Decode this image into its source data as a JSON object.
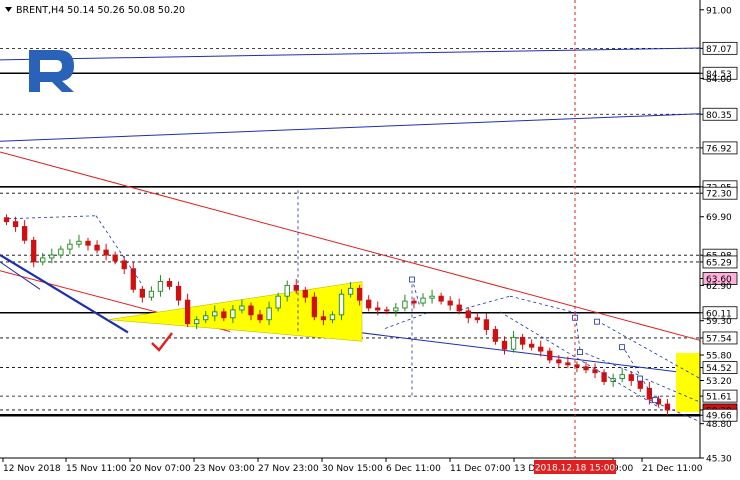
{
  "window": {
    "symbol_line": "BRENT,H4  50.14 50.26 50.08 50.20"
  },
  "logo": {
    "letter": "R",
    "color": "#2a62b8"
  },
  "colors": {
    "candle_bull": "#1a8a1a",
    "candle_bear": "#d01010",
    "trend_red": "#e02020",
    "trend_blue": "#1c2fb0",
    "triangle_fill": "#ffff00",
    "marker_fill": "#ffb0d8",
    "crosshair_label_bg": "#e02020"
  },
  "crosshair": {
    "time_label": "2018.12.18 15:00",
    "price": 63.6
  },
  "price_axis": {
    "ticks": [
      "91.00",
      "87.07",
      "84.53",
      "84.00",
      "80.35",
      "76.92",
      "72.95",
      "72.30",
      "69.90",
      "65.98",
      "65.29",
      "63.60",
      "62.90",
      "60.11",
      "59.30",
      "57.54",
      "55.80",
      "54.52",
      "53.20",
      "51.61",
      "50.20",
      "49.66",
      "48.80",
      "45.30"
    ],
    "boxed": [
      "87.07",
      "84.53",
      "80.35",
      "76.92",
      "72.95",
      "72.30",
      "65.98",
      "65.29",
      "63.60",
      "60.11",
      "57.54",
      "54.52",
      "51.61",
      "50.20",
      "49.66"
    ]
  },
  "time_axis": {
    "labels": [
      "12 Nov 2018",
      "15 Nov 11:00",
      "20 Nov 07:00",
      "23 Nov 03:00",
      "27 Nov 23:00",
      "30 Nov 15:00",
      "6 Dec 11:00",
      "11 Dec 07:00",
      "13 D",
      "9:00",
      "21 Dec 11:00"
    ]
  },
  "icons": {
    "menu": "triangle-down-icon",
    "check": "checkmark-icon"
  },
  "chart_data": {
    "type": "candlestick",
    "ylim": [
      45.3,
      92.0
    ],
    "horizontal_levels": [
      87.07,
      84.53,
      80.35,
      76.92,
      72.95,
      72.3,
      65.98,
      65.29,
      60.11,
      57.54,
      54.52,
      51.61,
      50.2,
      49.66
    ],
    "close_path": [
      69.4,
      68.9,
      67.5,
      65.3,
      65.7,
      66.0,
      66.6,
      67.1,
      67.4,
      67.0,
      66.5,
      66.0,
      65.4,
      64.6,
      62.5,
      61.7,
      62.3,
      63.3,
      62.8,
      61.4,
      59.0,
      59.4,
      59.8,
      60.2,
      59.6,
      60.4,
      60.8,
      59.9,
      59.4,
      60.6,
      61.8,
      62.9,
      62.4,
      61.7,
      59.7,
      59.4,
      59.9,
      62.0,
      62.6,
      61.4,
      60.6,
      60.4,
      60.3,
      60.6,
      61.3,
      61.1,
      61.6,
      61.8,
      61.3,
      60.9,
      60.3,
      59.6,
      59.4,
      58.4,
      57.2,
      56.4,
      57.6,
      56.9,
      56.6,
      56.2,
      55.3,
      55.0,
      54.8,
      54.6,
      54.3,
      54.0,
      53.1,
      53.4,
      53.8,
      53.2,
      52.4,
      51.3,
      50.8,
      50.2
    ]
  }
}
